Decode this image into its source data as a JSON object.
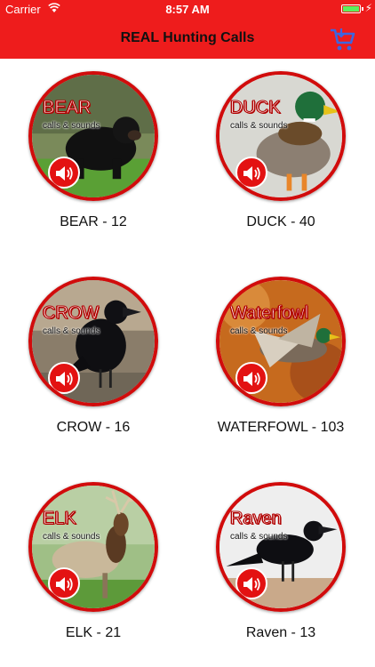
{
  "status": {
    "carrier": "Carrier",
    "time": "8:57 AM"
  },
  "nav": {
    "title": "REAL Hunting Calls"
  },
  "colors": {
    "brand_red": "#ee1c1c",
    "ring_red": "#d10c0c",
    "cart_blue": "#3d66e0"
  },
  "icons": {
    "cart": "shopping-cart-icon",
    "speaker": "speaker-icon"
  },
  "animals": [
    {
      "name": "BEAR",
      "subtitle": "calls & sounds",
      "caption": "BEAR - 12"
    },
    {
      "name": "DUCK",
      "subtitle": "calls & sounds",
      "caption": "DUCK - 40"
    },
    {
      "name": "CROW",
      "subtitle": "calls & sounds",
      "caption": "CROW - 16"
    },
    {
      "name": "Waterfowl",
      "subtitle": "calls & sounds",
      "caption": "WATERFOWL - 103"
    },
    {
      "name": "ELK",
      "subtitle": "calls & sounds",
      "caption": "ELK - 21"
    },
    {
      "name": "Raven",
      "subtitle": "calls & sounds",
      "caption": "Raven - 13"
    }
  ]
}
